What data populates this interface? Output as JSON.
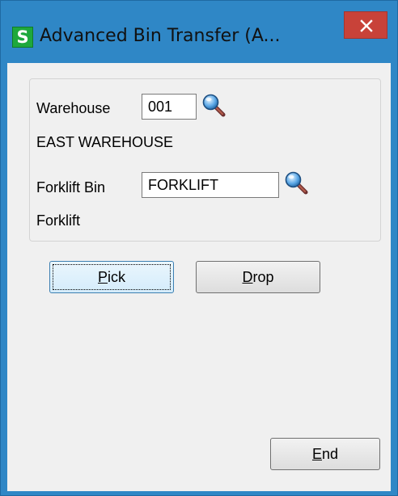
{
  "window": {
    "title": "Advanced Bin Transfer (A...",
    "app_icon_letter": "S",
    "app_icon_color": "#1ea83c",
    "titlebar_color": "#2f87c6",
    "close_color": "#c84239"
  },
  "form": {
    "warehouse_label": "Warehouse",
    "warehouse_value": "001",
    "warehouse_description": "EAST WAREHOUSE",
    "forklift_bin_label": "Forklift Bin",
    "forklift_bin_value": "FORKLIFT",
    "forklift_bin_description": "Forklift",
    "lookup_icon": "magnifier-icon"
  },
  "buttons": {
    "pick": {
      "accel": "P",
      "rest": "ick"
    },
    "drop": {
      "accel": "D",
      "rest": "rop"
    },
    "end": {
      "accel": "E",
      "rest": "nd"
    }
  }
}
